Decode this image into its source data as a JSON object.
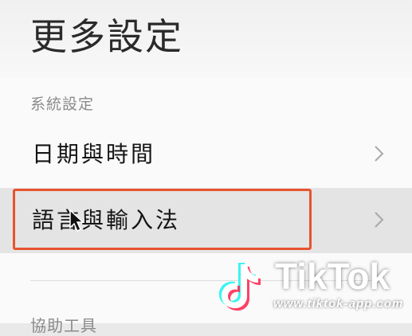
{
  "page": {
    "title": "更多設定"
  },
  "sections": [
    {
      "header": "系統設定",
      "items": [
        {
          "label": "日期與時間",
          "icon": "chevron-right-icon"
        },
        {
          "label": "語言與輸入法",
          "icon": "chevron-right-icon",
          "highlighted": true
        }
      ]
    },
    {
      "header": "協助工具"
    }
  ],
  "watermark": {
    "brand": "TikTok",
    "url": "www.tiktok-app.com"
  },
  "colors": {
    "highlight_border": "#e8532f",
    "text_primary": "#151515",
    "text_secondary": "#8a8a8a"
  }
}
